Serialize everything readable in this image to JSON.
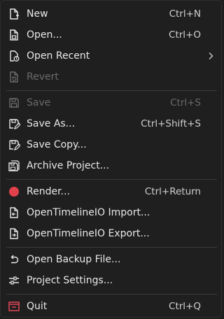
{
  "menu": {
    "items": [
      {
        "label": "New",
        "shortcut": "Ctrl+N",
        "icon": "new-file-icon"
      },
      {
        "label": "Open...",
        "shortcut": "Ctrl+O",
        "icon": "open-file-icon"
      },
      {
        "label": "Open Recent",
        "shortcut": "",
        "icon": "open-recent-icon",
        "submenu": true
      },
      {
        "label": "Revert",
        "shortcut": "",
        "icon": "revert-icon",
        "disabled": true
      },
      {
        "label": "Save",
        "shortcut": "Ctrl+S",
        "icon": "save-icon",
        "disabled": true
      },
      {
        "label": "Save As...",
        "shortcut": "Ctrl+Shift+S",
        "icon": "save-as-icon"
      },
      {
        "label": "Save Copy...",
        "shortcut": "",
        "icon": "save-copy-icon"
      },
      {
        "label": "Archive Project...",
        "shortcut": "",
        "icon": "archive-icon"
      },
      {
        "label": "Render...",
        "shortcut": "Ctrl+Return",
        "icon": "render-record-icon"
      },
      {
        "label": "OpenTimelineIO Import...",
        "shortcut": "",
        "icon": "otio-import-icon"
      },
      {
        "label": "OpenTimelineIO Export...",
        "shortcut": "",
        "icon": "otio-export-icon"
      },
      {
        "label": "Open Backup File...",
        "shortcut": "",
        "icon": "undo-arrow-icon"
      },
      {
        "label": "Project Settings...",
        "shortcut": "",
        "icon": "settings-sliders-icon"
      },
      {
        "label": "Quit",
        "shortcut": "Ctrl+Q",
        "icon": "quit-icon"
      }
    ]
  },
  "colors": {
    "background": "#1f1f1f",
    "text": "#e8e8e8",
    "disabled_text": "#6b6b6b",
    "separator": "#3a3a3a",
    "render_red": "#e0414b",
    "quit_red": "#e04658"
  }
}
